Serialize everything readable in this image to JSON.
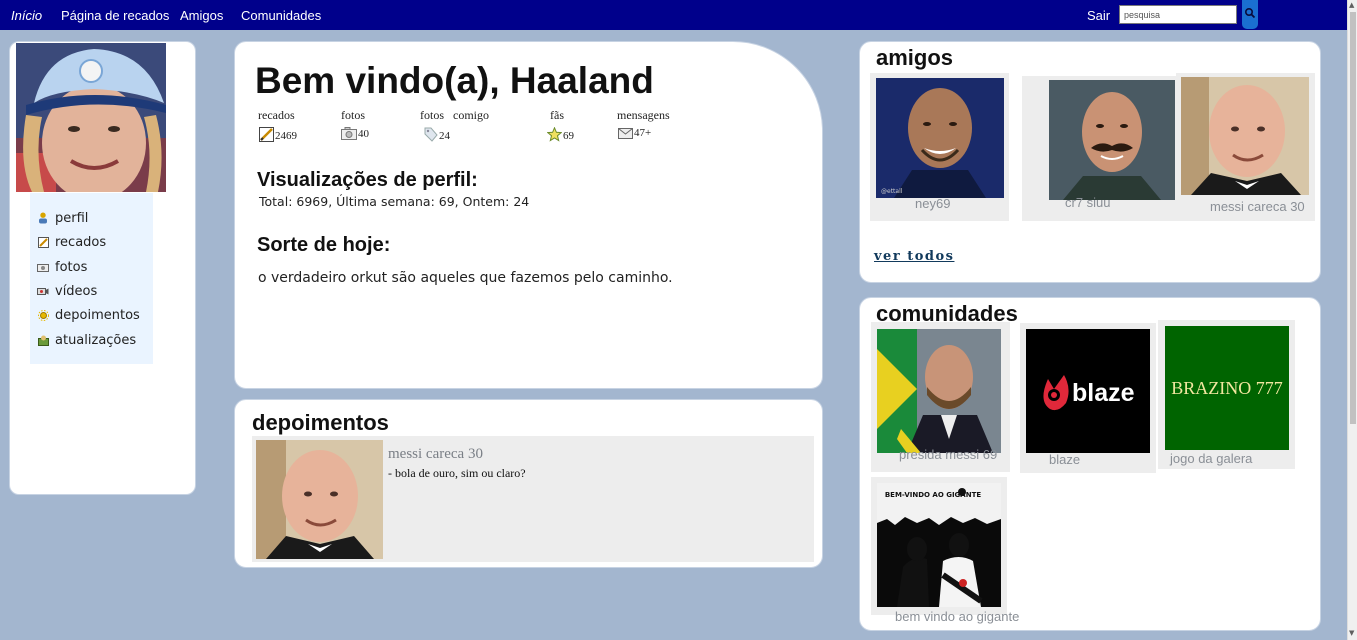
{
  "nav": {
    "links": [
      "Início",
      "Página de recados",
      "Amigos",
      "Comunidades"
    ],
    "sair": "Sair",
    "search_placeholder": "pesquisa",
    "search_icon": "search-icon"
  },
  "sidebar": {
    "items": [
      {
        "label": "perfil",
        "icon": "user-icon"
      },
      {
        "label": "recados",
        "icon": "note-icon"
      },
      {
        "label": "fotos",
        "icon": "camera-icon"
      },
      {
        "label": "vídeos",
        "icon": "video-icon"
      },
      {
        "label": "depoimentos",
        "icon": "sun-icon"
      },
      {
        "label": "atualizações",
        "icon": "updates-icon"
      }
    ]
  },
  "profile": {
    "welcome": "Bem vindo(a), Haaland",
    "stats": [
      {
        "label": "recados",
        "value": "2469",
        "icon": "note-icon"
      },
      {
        "label": "fotos",
        "value": "40",
        "icon": "camera-icon"
      },
      {
        "label": "fotos   comigo",
        "value": "24",
        "icon": "tag-icon"
      },
      {
        "label": "fãs",
        "value": "69",
        "icon": "star-icon"
      },
      {
        "label": "mensagens",
        "value": "47+",
        "icon": "envelope-icon"
      }
    ],
    "views_title": "Visualizações de perfil:",
    "views_text": "Total: 6969, Última semana: 69, Ontem: 24",
    "luck_title": "Sorte de hoje:",
    "luck_text": "o verdadeiro orkut são aqueles que fazemos pelo caminho."
  },
  "testimonials": {
    "title": "depoimentos",
    "items": [
      {
        "author": "messi careca 30",
        "text": "- bola de ouro, sim ou claro?"
      }
    ]
  },
  "friends": {
    "title": "amigos",
    "items": [
      {
        "name": "ney69"
      },
      {
        "name": "cr7 siuu"
      },
      {
        "name": "messi careca 30"
      }
    ],
    "see_all": "ver todos"
  },
  "communities": {
    "title": "comunidades",
    "items": [
      {
        "name": "presida messi 69"
      },
      {
        "name": "blaze",
        "logo_text": "blaze"
      },
      {
        "name": "jogo da galera",
        "logo_text": "BRAZINO 777"
      },
      {
        "name": "bem vindo ao gigante",
        "logo_text": "BEM-VINDO AO GIGANTE"
      }
    ]
  },
  "colors": {
    "nav_bg": "#00008b",
    "page_bg": "#a3b6cf",
    "sidebar_bg": "#eaf4ff",
    "link": "#123a5c",
    "brazino_green": "#006400"
  }
}
